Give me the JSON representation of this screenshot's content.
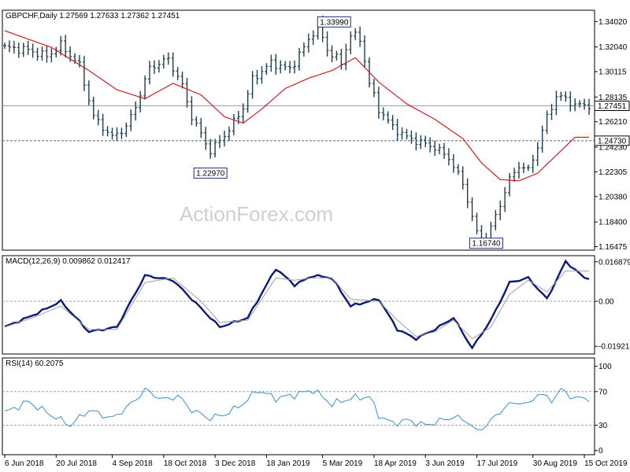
{
  "watermark": "ActionForex.com",
  "colors": {
    "price": "#1f3f4f",
    "ma": "#cc1f1f",
    "macd": "#0a1a7a",
    "signal": "#a0a0a0",
    "rsi": "#3a8fd0",
    "line_level": "#a0a0a0",
    "dashed_level": "#606060"
  },
  "chart_data": [
    {
      "type": "ohlc",
      "title": "GBPCHF,Daily  1.27569 1.27633 1.27362 1.27451",
      "ylim": [
        1.162,
        1.349
      ],
      "y_ticks": [
        "1.34020",
        "1.32040",
        "1.30115",
        "1.28135",
        "1.26210",
        "1.24230",
        "1.22305",
        "1.20380",
        "1.18400",
        "1.16475"
      ],
      "y_tick_values": [
        1.3402,
        1.3204,
        1.30115,
        1.28135,
        1.2621,
        1.2423,
        1.22305,
        1.2038,
        1.184,
        1.16475
      ],
      "levels": [
        {
          "value": 1.27451,
          "label": "1.27451",
          "style": "solid"
        },
        {
          "value": 1.2473,
          "label": "1.24730",
          "style": "dashed"
        }
      ],
      "annotations": [
        {
          "text": "1.33990",
          "value": 1.3399,
          "date_index": 74
        },
        {
          "text": "1.22970",
          "value": 1.2297,
          "date_index": 44
        },
        {
          "text": "1.16740",
          "value": 1.1674,
          "date_index": 103
        }
      ],
      "close_anchors": [
        [
          0,
          1.32
        ],
        [
          5,
          1.318
        ],
        [
          9,
          1.313
        ],
        [
          12,
          1.322
        ],
        [
          16,
          1.306
        ],
        [
          19,
          1.266
        ],
        [
          23,
          1.25
        ],
        [
          26,
          1.258
        ],
        [
          28,
          1.274
        ],
        [
          31,
          1.304
        ],
        [
          35,
          1.311
        ],
        [
          38,
          1.29
        ],
        [
          40,
          1.266
        ],
        [
          44,
          1.239
        ],
        [
          48,
          1.256
        ],
        [
          51,
          1.273
        ],
        [
          53,
          1.295
        ],
        [
          57,
          1.308
        ],
        [
          61,
          1.303
        ],
        [
          64,
          1.32
        ],
        [
          67,
          1.338
        ],
        [
          69,
          1.318
        ],
        [
          72,
          1.308
        ],
        [
          74,
          1.33
        ],
        [
          76,
          1.327
        ],
        [
          78,
          1.292
        ],
        [
          80,
          1.272
        ],
        [
          83,
          1.258
        ],
        [
          86,
          1.25
        ],
        [
          89,
          1.246
        ],
        [
          92,
          1.242
        ],
        [
          95,
          1.234
        ],
        [
          98,
          1.214
        ],
        [
          101,
          1.175
        ],
        [
          103,
          1.17
        ],
        [
          106,
          1.198
        ],
        [
          108,
          1.217
        ],
        [
          110,
          1.228
        ],
        [
          112,
          1.224
        ],
        [
          114,
          1.243
        ],
        [
          116,
          1.266
        ],
        [
          118,
          1.282
        ],
        [
          120,
          1.28
        ],
        [
          122,
          1.275
        ]
      ],
      "ma_anchors": [
        [
          0,
          1.333
        ],
        [
          10,
          1.32
        ],
        [
          18,
          1.302
        ],
        [
          24,
          1.287
        ],
        [
          30,
          1.28
        ],
        [
          36,
          1.292
        ],
        [
          42,
          1.283
        ],
        [
          47,
          1.266
        ],
        [
          51,
          1.261
        ],
        [
          55,
          1.272
        ],
        [
          60,
          1.288
        ],
        [
          65,
          1.296
        ],
        [
          70,
          1.302
        ],
        [
          75,
          1.312
        ],
        [
          80,
          1.293
        ],
        [
          86,
          1.276
        ],
        [
          92,
          1.264
        ],
        [
          98,
          1.249
        ],
        [
          102,
          1.23
        ],
        [
          106,
          1.217
        ],
        [
          110,
          1.216
        ],
        [
          114,
          1.222
        ],
        [
          118,
          1.236
        ],
        [
          122,
          1.25
        ]
      ]
    },
    {
      "type": "line",
      "title": "MACD(12,26,9) 0.009862 0.012417",
      "ylim": [
        -0.0225,
        0.0195
      ],
      "y_ticks": [
        "0.016879",
        "0.00",
        "-0.019214"
      ],
      "y_tick_values": [
        0.016879,
        0.0,
        -0.019214
      ],
      "levels": [
        {
          "value": 0.0,
          "style": "dashed"
        }
      ],
      "series": [
        {
          "kind": "macd",
          "anchors": [
            [
              0,
              -0.011
            ],
            [
              6,
              -0.006
            ],
            [
              12,
              0.0
            ],
            [
              18,
              -0.013
            ],
            [
              24,
              -0.011
            ],
            [
              30,
              0.011
            ],
            [
              36,
              0.009
            ],
            [
              42,
              -0.003
            ],
            [
              46,
              -0.011
            ],
            [
              52,
              -0.007
            ],
            [
              58,
              0.014
            ],
            [
              62,
              0.007
            ],
            [
              66,
              0.011
            ],
            [
              70,
              0.01
            ],
            [
              74,
              -0.002
            ],
            [
              80,
              0.001
            ],
            [
              84,
              -0.012
            ],
            [
              88,
              -0.016
            ],
            [
              92,
              -0.012
            ],
            [
              96,
              -0.007
            ],
            [
              100,
              -0.02
            ],
            [
              104,
              -0.008
            ],
            [
              108,
              0.008
            ],
            [
              112,
              0.01
            ],
            [
              116,
              0.001
            ],
            [
              120,
              0.017
            ],
            [
              124,
              0.01
            ]
          ]
        },
        {
          "kind": "signal",
          "anchors": [
            [
              0,
              -0.011
            ],
            [
              6,
              -0.007
            ],
            [
              12,
              -0.002
            ],
            [
              18,
              -0.012
            ],
            [
              24,
              -0.012
            ],
            [
              30,
              0.008
            ],
            [
              36,
              0.01
            ],
            [
              42,
              0.0
            ],
            [
              46,
              -0.009
            ],
            [
              52,
              -0.008
            ],
            [
              58,
              0.01
            ],
            [
              62,
              0.009
            ],
            [
              66,
              0.01
            ],
            [
              70,
              0.01
            ],
            [
              74,
              0.001
            ],
            [
              80,
              0.0
            ],
            [
              84,
              -0.008
            ],
            [
              88,
              -0.015
            ],
            [
              92,
              -0.013
            ],
            [
              96,
              -0.008
            ],
            [
              100,
              -0.016
            ],
            [
              104,
              -0.011
            ],
            [
              108,
              0.003
            ],
            [
              112,
              0.009
            ],
            [
              116,
              0.004
            ],
            [
              120,
              0.013
            ],
            [
              124,
              0.013
            ]
          ]
        }
      ]
    },
    {
      "type": "line",
      "title": "RSI(14) 60.2075",
      "ylim": [
        -5,
        110
      ],
      "y_ticks": [
        "100",
        "70",
        "30",
        "0"
      ],
      "y_tick_values": [
        100,
        70,
        30,
        0
      ],
      "levels": [
        {
          "value": 70,
          "style": "dashed"
        },
        {
          "value": 30,
          "style": "dashed"
        }
      ],
      "series": [
        {
          "kind": "rsi",
          "anchors": [
            [
              0,
              45
            ],
            [
              5,
              58
            ],
            [
              10,
              42
            ],
            [
              14,
              30
            ],
            [
              18,
              48
            ],
            [
              23,
              38
            ],
            [
              27,
              55
            ],
            [
              30,
              72
            ],
            [
              34,
              60
            ],
            [
              37,
              65
            ],
            [
              40,
              48
            ],
            [
              44,
              38
            ],
            [
              48,
              45
            ],
            [
              52,
              60
            ],
            [
              54,
              72
            ],
            [
              58,
              62
            ],
            [
              62,
              66
            ],
            [
              66,
              72
            ],
            [
              70,
              55
            ],
            [
              74,
              62
            ],
            [
              78,
              64
            ],
            [
              80,
              42
            ],
            [
              83,
              32
            ],
            [
              86,
              36
            ],
            [
              90,
              30
            ],
            [
              93,
              35
            ],
            [
              96,
              40
            ],
            [
              99,
              35
            ],
            [
              101,
              22
            ],
            [
              104,
              35
            ],
            [
              107,
              52
            ],
            [
              110,
              58
            ],
            [
              112,
              54
            ],
            [
              114,
              68
            ],
            [
              117,
              60
            ],
            [
              119,
              72
            ],
            [
              122,
              62
            ]
          ]
        }
      ]
    }
  ],
  "x_axis": {
    "count": 126,
    "ticks": [
      {
        "label": "6 Jun 2018",
        "index": 0
      },
      {
        "label": "20 Jul 2018",
        "index": 11
      },
      {
        "label": "4 Sep 2018",
        "index": 23
      },
      {
        "label": "18 Oct 2018",
        "index": 34
      },
      {
        "label": "3 Dec 2018",
        "index": 45
      },
      {
        "label": "18 Jan 2019",
        "index": 56
      },
      {
        "label": "5 Mar 2019",
        "index": 68
      },
      {
        "label": "18 Apr 2019",
        "index": 79
      },
      {
        "label": "3 Jun 2019",
        "index": 90
      },
      {
        "label": "17 Jul 2019",
        "index": 101
      },
      {
        "label": "30 Aug 2019",
        "index": 113
      },
      {
        "label": "15 Oct 2019",
        "index": 124
      }
    ]
  }
}
